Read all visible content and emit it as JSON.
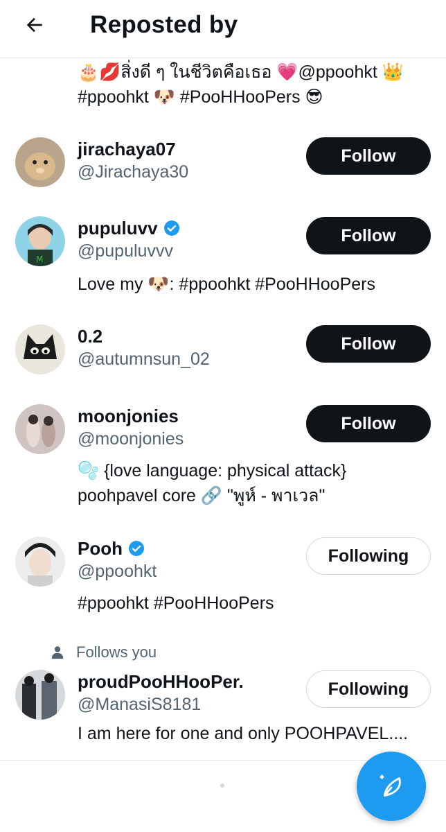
{
  "header": {
    "title": "Reposted by",
    "back_icon": "arrow-left-icon"
  },
  "top_bio_continuation": {
    "line1": "🎂💋สิ่งดี ๆ ในชีวิตคือเธอ 💗@ppoohkt 👑",
    "line2": "#ppoohkt 🐶 #PooHHooPers 😎"
  },
  "users": [
    {
      "name": "jirachaya07",
      "handle": "@Jirachaya30",
      "verified": false,
      "button": "Follow",
      "bio": ""
    },
    {
      "name": "pupuluvv",
      "handle": "@pupuluvvv",
      "verified": true,
      "button": "Follow",
      "bio": "Love my 🐶: #ppoohkt #PooHHooPers"
    },
    {
      "name": "0.2",
      "handle": "@autumnsun_02",
      "verified": false,
      "button": "Follow",
      "bio": ""
    },
    {
      "name": "moonjonies",
      "handle": "@moonjonies",
      "verified": false,
      "button": "Follow",
      "bio_line1": "🫧 {love language: physical attack}",
      "bio_line2": "poohpavel core 🔗 \"พูห์ - พาเวล\""
    },
    {
      "name": "Pooh",
      "handle": "@ppoohkt",
      "verified": true,
      "button": "Following",
      "bio": "#ppoohkt #PooHHooPers"
    },
    {
      "name": "proudPooHHooPer.",
      "handle": "@ManasiS8181",
      "verified": false,
      "button": "Following",
      "bio": "I am here for one and only POOHPAVEL....",
      "context": "Follows you"
    }
  ],
  "fab": {
    "icon": "compose-post-icon"
  },
  "colors": {
    "accent": "#1d9bf0",
    "text": "#0f1419",
    "muted": "#536471",
    "follow_bg": "#0f1419"
  }
}
